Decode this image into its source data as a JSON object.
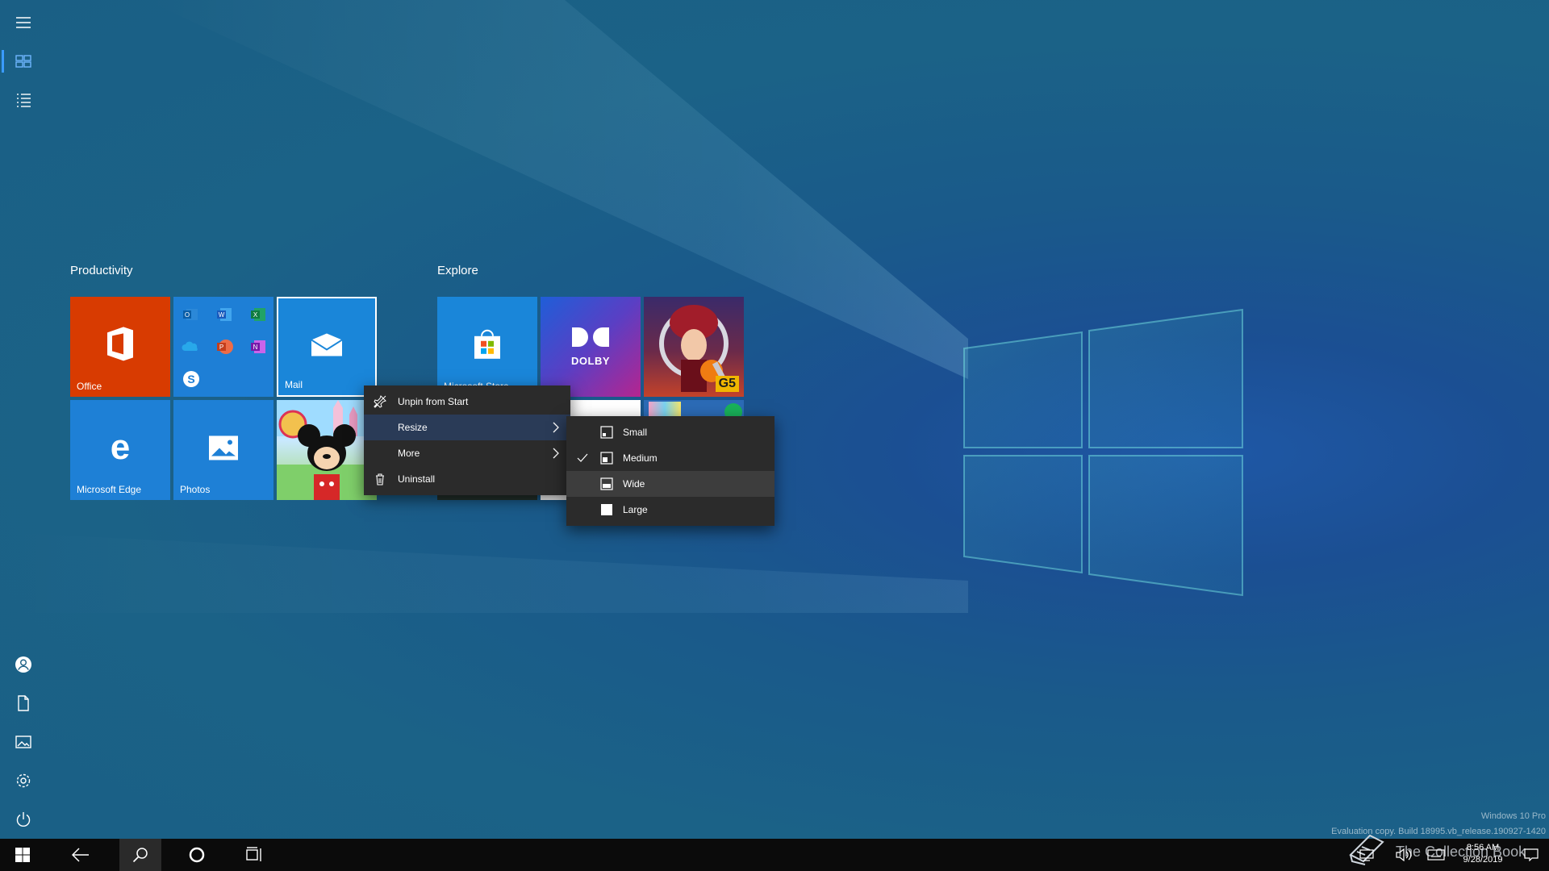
{
  "colors": {
    "accent": "#0078d7",
    "office_tile": "#d83b01",
    "menu_bg": "#2b2b2b",
    "menu_highlight": "#2a3b57",
    "taskbar": "#0b0b0b"
  },
  "groups": [
    {
      "title": "Productivity"
    },
    {
      "title": "Explore"
    }
  ],
  "tiles": {
    "office": "Office",
    "mail": "Mail",
    "edge": "Microsoft Edge",
    "photos": "Photos",
    "store": "Microsoft Store",
    "dolby_text": "DOLBY",
    "g5_badge": "G5"
  },
  "context_menu": {
    "items": [
      {
        "label": "Unpin from Start",
        "icon": "unpin-icon"
      },
      {
        "label": "Resize",
        "icon": "none",
        "has_submenu": true
      },
      {
        "label": "More",
        "icon": "none",
        "has_submenu": true
      },
      {
        "label": "Uninstall",
        "icon": "trash-icon"
      }
    ]
  },
  "resize_submenu": {
    "items": [
      {
        "label": "Small",
        "checked": false
      },
      {
        "label": "Medium",
        "checked": true
      },
      {
        "label": "Wide",
        "checked": false
      },
      {
        "label": "Large",
        "checked": false
      }
    ]
  },
  "rail": {
    "items": [
      "hamburger-menu-icon",
      "tiles-view-icon",
      "all-apps-list-icon",
      "user-icon",
      "documents-icon",
      "pictures-icon",
      "settings-gear-icon",
      "power-icon"
    ]
  },
  "taskbar": {
    "time": "8:56 AM",
    "date": "9/28/2019",
    "icons": [
      "windows-start-icon",
      "back-arrow-icon",
      "search-icon",
      "cortana-circle-icon",
      "task-view-icon",
      "network-icon",
      "volume-icon",
      "keyboard-icon",
      "notification-icon"
    ]
  },
  "watermark": {
    "line1": "Windows 10 Pro",
    "line2": "Evaluation copy. Build 18995.vb_release.190927-1420",
    "brand": "The Collection Book"
  }
}
